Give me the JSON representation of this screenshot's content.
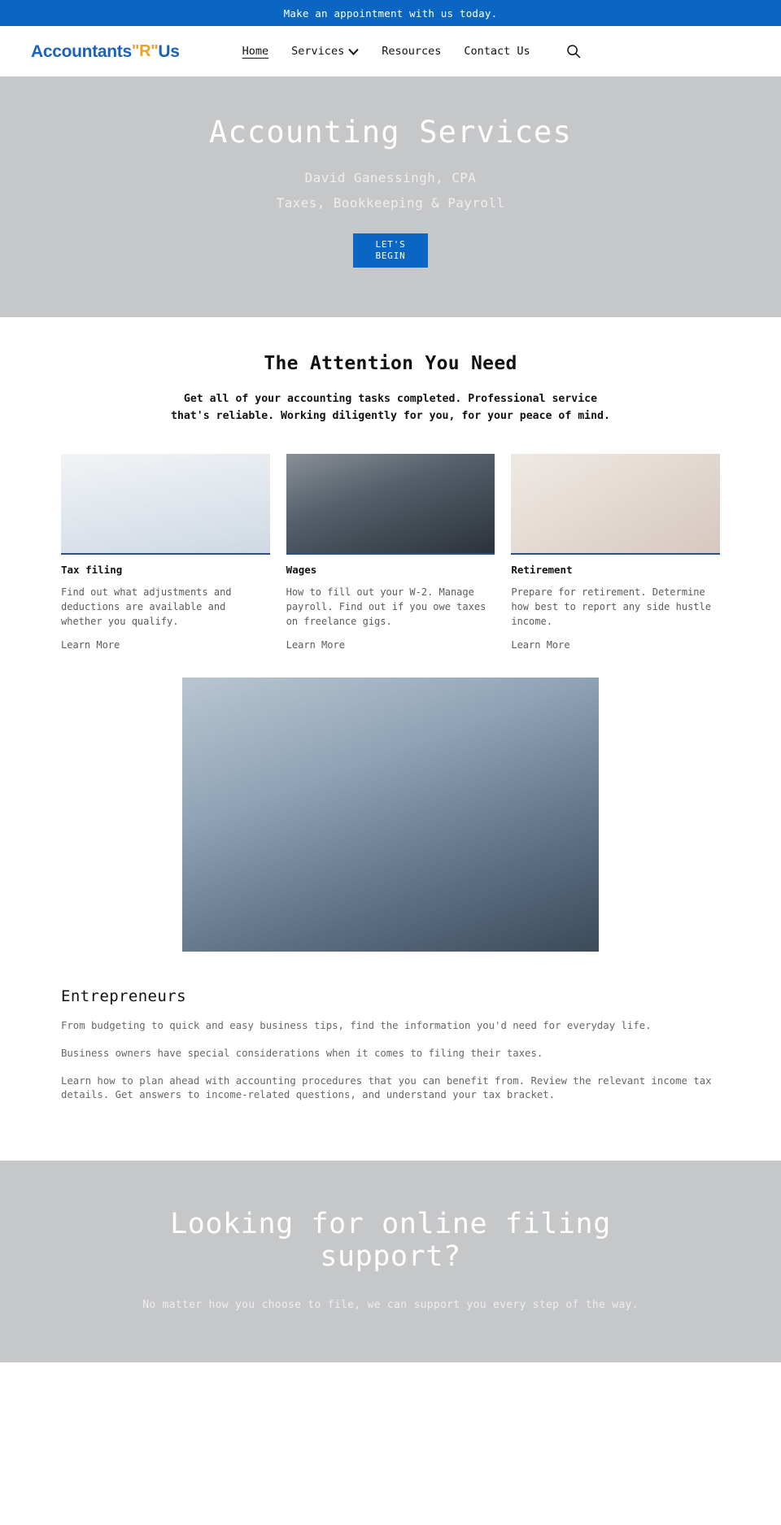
{
  "announcement": {
    "text": "Make an appointment with us today."
  },
  "header": {
    "logo": {
      "part1": "Accountants",
      "r_mark": "\"R\"",
      "part2": "Us"
    },
    "nav": [
      {
        "label": "Home",
        "active": true,
        "has_caret": false
      },
      {
        "label": "Services",
        "active": false,
        "has_caret": true
      },
      {
        "label": "Resources",
        "active": false,
        "has_caret": false
      },
      {
        "label": "Contact Us",
        "active": false,
        "has_caret": false
      }
    ],
    "search_icon": "search-icon"
  },
  "hero": {
    "title": "Accounting Services",
    "subtitle1": "David Ganessingh, CPA",
    "subtitle2": "Taxes, Bookkeeping & Payroll",
    "cta_line1": "LET'S",
    "cta_line2": "BEGIN"
  },
  "attention": {
    "title": "The Attention You Need",
    "text": "Get all of your accounting tasks completed. Professional service that's reliable. Working diligently for you, for your peace of mind."
  },
  "cards": [
    {
      "image_name": "tax-filing-photo",
      "title": "Tax filing",
      "description": "Find out what adjustments and deductions are available and whether you qualify.",
      "link_label": "Learn More"
    },
    {
      "image_name": "wages-photo",
      "title": "Wages",
      "description": "How to fill out your W-2. Manage payroll. Find out if you owe taxes on freelance gigs.",
      "link_label": "Learn More"
    },
    {
      "image_name": "retirement-photo",
      "title": "Retirement",
      "description": "Prepare for retirement. Determine how best to report any side hustle income.",
      "link_label": "Learn More"
    }
  ],
  "feature": {
    "image_name": "team-meeting-photo"
  },
  "entrepreneurs": {
    "title": "Entrepreneurs",
    "paragraph1": "From budgeting to quick and easy business tips, find the information you'd need for everyday life.",
    "paragraph2": "Business owners have special considerations when it comes to filing their taxes.",
    "paragraph3": "Learn how to plan ahead with accounting procedures that you can benefit from. Review the relevant income tax details. Get answers to income-related questions, and understand your tax bracket."
  },
  "bottom_cta": {
    "title": "Looking for online filing support?",
    "subtitle": "No matter how you choose to file, we can support you every step of the way."
  },
  "colors": {
    "brand_blue": "#0b66c3",
    "logo_blue": "#1a63b8",
    "logo_orange": "#f0a01e",
    "hero_gray": "#c6c7c9",
    "card_underline": "#2b4f7e"
  }
}
